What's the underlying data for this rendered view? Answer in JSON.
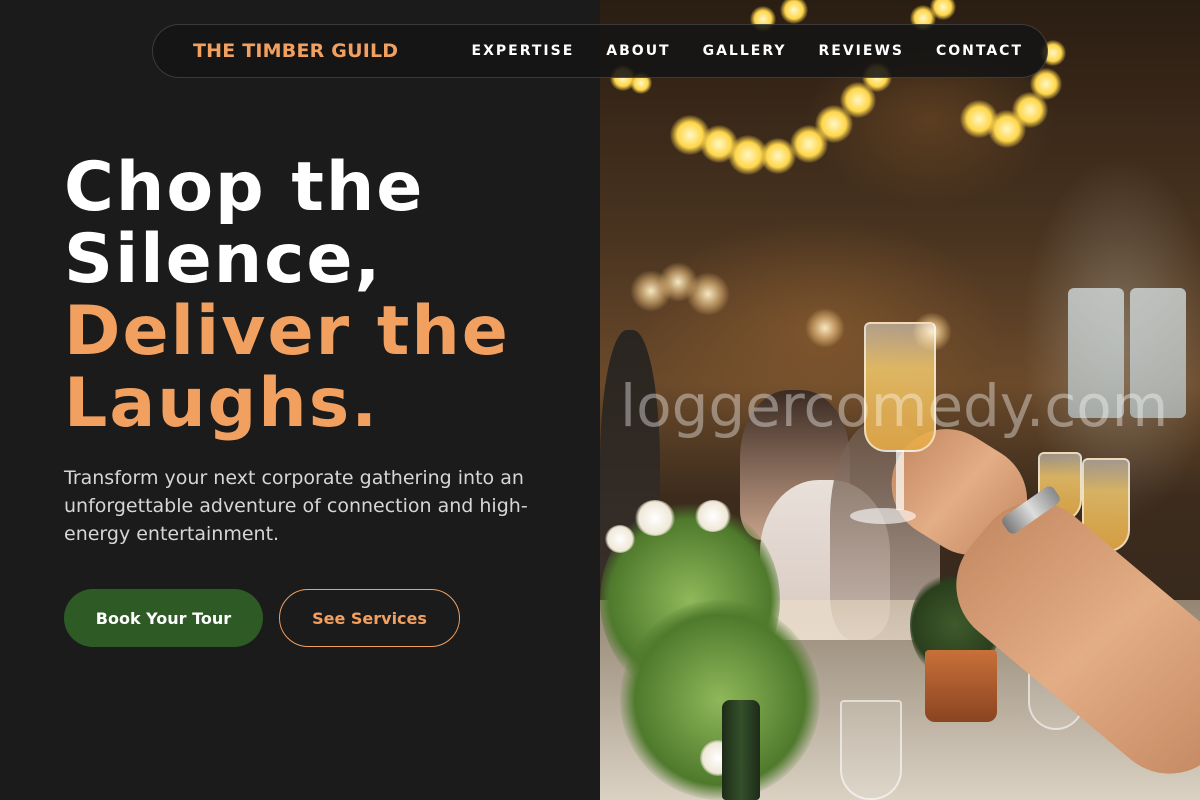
{
  "nav": {
    "brand": "THE TIMBER GUILD",
    "links": [
      "EXPERTISE",
      "ABOUT",
      "GALLERY",
      "REVIEWS",
      "CONTACT"
    ]
  },
  "hero": {
    "title_line1": "Chop the",
    "title_line2": "Silence,",
    "title_accent_line1": "Deliver the",
    "title_accent_line2": "Laughs.",
    "subtitle": "Transform your next corporate gathering into an unforgettable adventure of connection and high-energy entertainment.",
    "primary_button": "Book Your Tour",
    "secondary_button": "See Services"
  },
  "image": {
    "watermark": "loggercomedy.com"
  },
  "colors": {
    "background": "#1b1b1b",
    "accent": "#f2a060",
    "primary_button": "#2e5a26",
    "text": "#ffffff",
    "subtext": "#d6d6d6"
  }
}
